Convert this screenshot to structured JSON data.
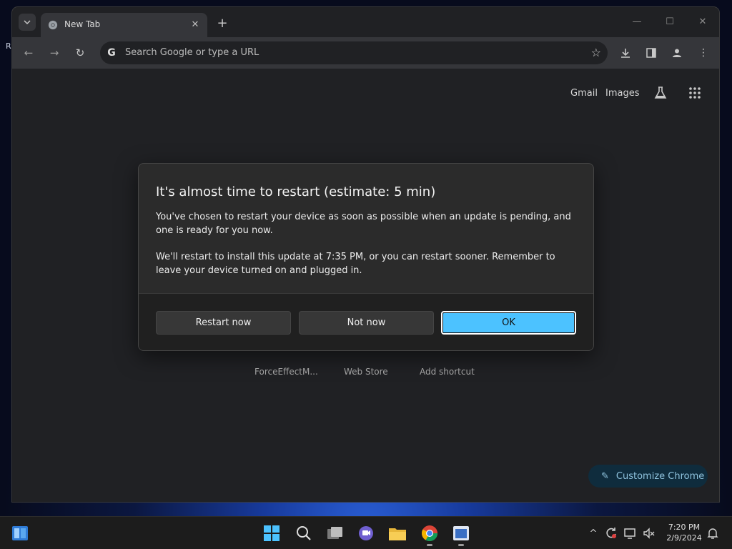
{
  "browser": {
    "tab": {
      "title": "New Tab"
    },
    "omnibox": {
      "placeholder": "Search Google or type a URL"
    },
    "newtab": {
      "top_links": [
        "Gmail",
        "Images"
      ],
      "shortcuts": [
        "ForceEffectM...",
        "Web Store",
        "Add shortcut"
      ],
      "customize_label": "Customize Chrome"
    }
  },
  "dialog": {
    "title": "It's almost time to restart (estimate: 5 min)",
    "paragraph1": "You've chosen to restart your device as soon as possible when an update is pending, and one is ready for you now.",
    "paragraph2": "We'll restart to install this update at 7:35 PM, or you can restart sooner. Remember to leave your device turned on and plugged in.",
    "buttons": {
      "restart_now": "Restart now",
      "not_now": "Not now",
      "ok": "OK"
    },
    "accent_color": "#4cc2ff"
  },
  "taskbar": {
    "clock_time": "7:20 PM",
    "clock_date": "2/9/2024",
    "icons": [
      "widgets-icon",
      "start-icon",
      "search-icon",
      "task-view-icon",
      "teams-chat-icon",
      "file-explorer-icon",
      "chrome-icon",
      "app-window-icon"
    ]
  },
  "desktop": {
    "fragment_text": "R"
  }
}
